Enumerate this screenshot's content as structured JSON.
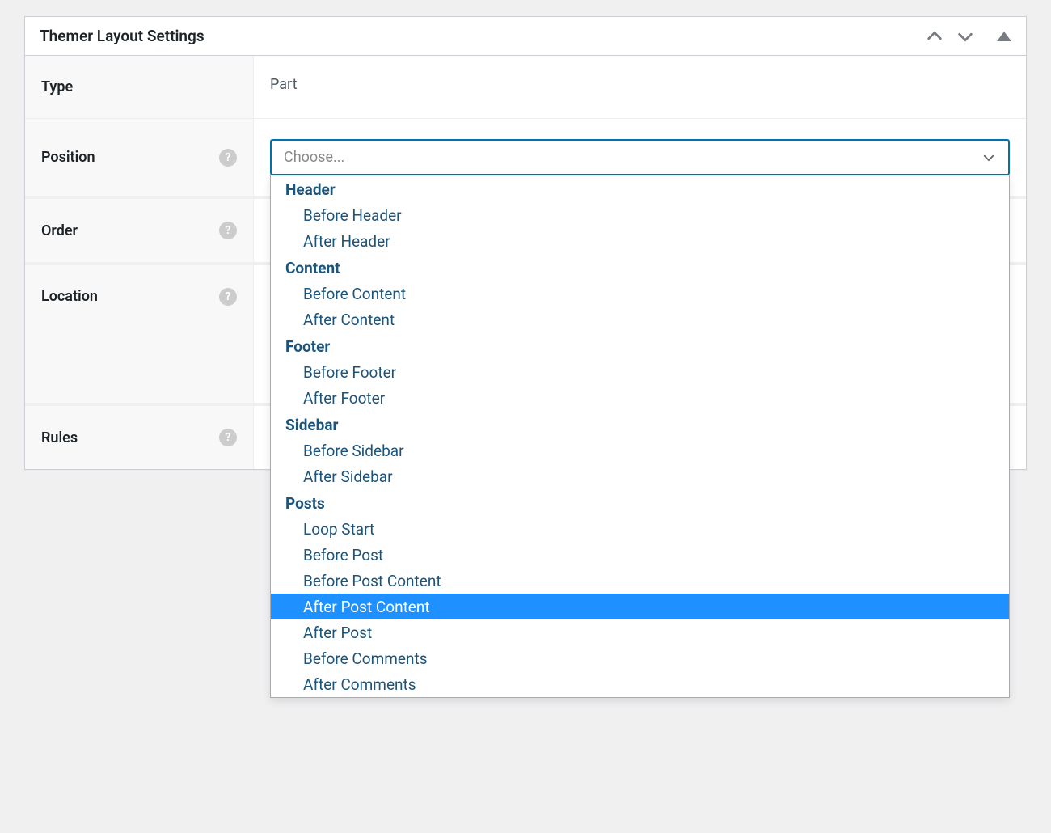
{
  "header": {
    "title": "Themer Layout Settings"
  },
  "rows": {
    "type": {
      "label": "Type",
      "value": "Part"
    },
    "position": {
      "label": "Position",
      "placeholder": "Choose..."
    },
    "order": {
      "label": "Order"
    },
    "location": {
      "label": "Location"
    },
    "rules": {
      "label": "Rules"
    }
  },
  "dropdown": {
    "highlighted": "After Post Content",
    "groups": [
      {
        "label": "Header",
        "items": [
          "Before Header",
          "After Header"
        ]
      },
      {
        "label": "Content",
        "items": [
          "Before Content",
          "After Content"
        ]
      },
      {
        "label": "Footer",
        "items": [
          "Before Footer",
          "After Footer"
        ]
      },
      {
        "label": "Sidebar",
        "items": [
          "Before Sidebar",
          "After Sidebar"
        ]
      },
      {
        "label": "Posts",
        "items": [
          "Loop Start",
          "Before Post",
          "Before Post Content",
          "After Post Content",
          "After Post",
          "Before Comments",
          "After Comments"
        ]
      }
    ]
  }
}
